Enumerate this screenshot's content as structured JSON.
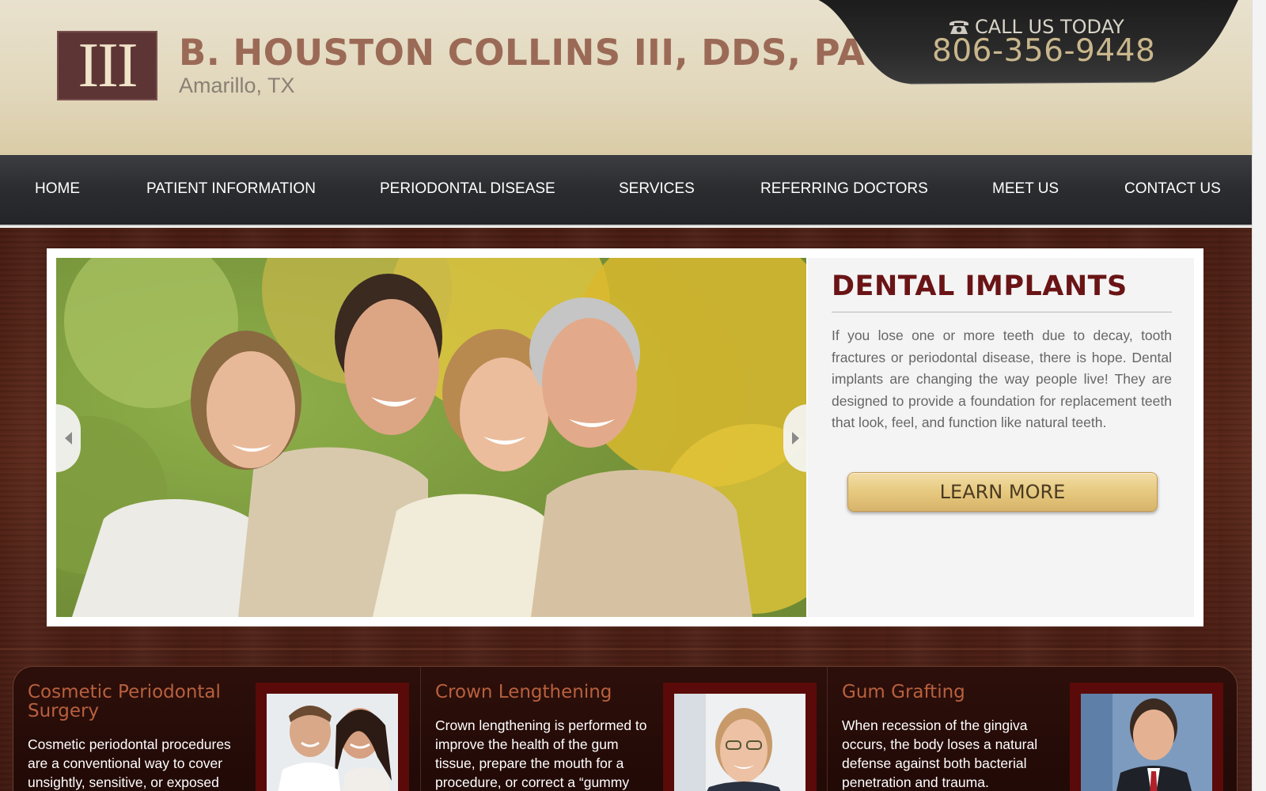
{
  "header": {
    "logo_text": "III",
    "title": "B. HOUSTON COLLINS III, DDS, PA",
    "subtitle": "Amarillo, TX",
    "call_label": "CALL US TODAY",
    "phone": "806-356-9448",
    "phone_icon": "telephone-icon"
  },
  "nav": {
    "items": [
      {
        "label": "HOME"
      },
      {
        "label": "PATIENT INFORMATION"
      },
      {
        "label": "PERIODONTAL DISEASE"
      },
      {
        "label": "SERVICES"
      },
      {
        "label": "REFERRING DOCTORS"
      },
      {
        "label": "MEET US"
      },
      {
        "label": "CONTACT US"
      }
    ]
  },
  "slider": {
    "heading": "DENTAL IMPLANTS",
    "body": "If you lose one or more teeth due to decay, tooth fractures or periodontal disease, there is hope. Dental implants are changing the way people live! They are designed to provide a foundation for replacement teeth that look, feel, and function like natural teeth.",
    "button_label": "LEARN MORE",
    "prev_icon": "chevron-left-icon",
    "next_icon": "chevron-right-icon"
  },
  "features": [
    {
      "title": "Cosmetic Periodontal Surgery",
      "text": "Cosmetic periodontal procedures are a conventional way to cover unsightly, sensitive, or exposed"
    },
    {
      "title": "Crown Lengthening",
      "text": "Crown lengthening is performed to improve the health of the gum tissue, prepare the mouth for a procedure, or correct a “gummy"
    },
    {
      "title": "Gum Grafting",
      "text": "When recession of the gingiva occurs, the body loses a natural defense against both bacterial penetration and trauma."
    }
  ],
  "colors": {
    "title": "#9b6a56",
    "nav_bg": "#2a2c2f",
    "heading": "#6a1416",
    "button": "#e6c97f",
    "feature_title": "#b8603e",
    "wood": "#5a2618"
  }
}
